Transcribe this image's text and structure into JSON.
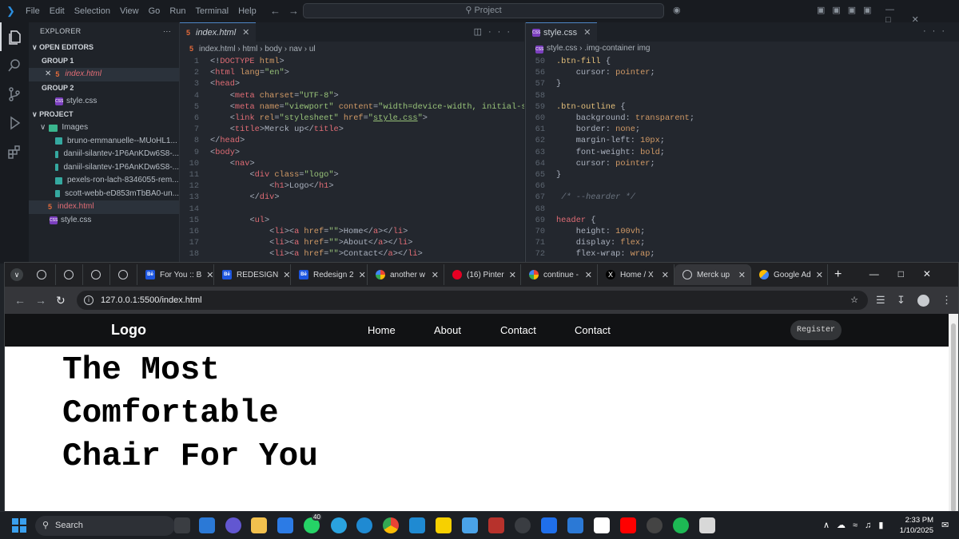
{
  "vscode": {
    "menu": [
      "File",
      "Edit",
      "Selection",
      "View",
      "Go",
      "Run",
      "Terminal",
      "Help"
    ],
    "command_center": "Project",
    "explorer": {
      "title": "EXPLORER",
      "open_editors": "OPEN EDITORS",
      "group1": "GROUP 1",
      "group1_file": "index.html",
      "group2": "GROUP 2",
      "group2_file": "style.css",
      "project": "PROJECT",
      "images_folder": "Images",
      "images": [
        "bruno-emmanuelle--MUoHL1...",
        "daniil-silantev-1P6AnKDw6S8-...",
        "daniil-silantev-1P6AnKDw6S8-...",
        "pexels-ron-lach-8346055-rem...",
        "scott-webb-eD853mTbBA0-un..."
      ],
      "files": [
        "index.html",
        "style.css"
      ]
    },
    "editor1": {
      "tab": "index.html",
      "crumbs": [
        "index.html",
        "html",
        "body",
        "nav",
        "ul"
      ]
    },
    "editor2": {
      "tab": "style.css",
      "crumbs": [
        "style.css",
        ".img-container img"
      ]
    }
  },
  "chrome": {
    "tabs": [
      {
        "title": "",
        "icon": "globe"
      },
      {
        "title": "",
        "icon": "globe"
      },
      {
        "title": "",
        "icon": "globe"
      },
      {
        "title": "",
        "icon": "globe"
      },
      {
        "title": "For You :: B",
        "icon": "behance"
      },
      {
        "title": "REDESIGN",
        "icon": "behance"
      },
      {
        "title": "Redesign 2",
        "icon": "behance"
      },
      {
        "title": "another w",
        "icon": "google"
      },
      {
        "title": "(16) Pinter",
        "icon": "pinterest"
      },
      {
        "title": "continue -",
        "icon": "google"
      },
      {
        "title": "Home / X",
        "icon": "x"
      },
      {
        "title": "Merck up",
        "icon": "globe"
      },
      {
        "title": "Google Ad",
        "icon": "ads"
      }
    ],
    "url": "127.0.0.1:5500/index.html"
  },
  "site": {
    "logo": "Logo",
    "nav": [
      "Home",
      "About",
      "Contact",
      "Contact"
    ],
    "register": "Register",
    "hero": [
      "The Most",
      "Comfortable",
      "Chair For You"
    ]
  },
  "taskbar": {
    "search": "Search",
    "badge": "40",
    "time": "2:33 PM",
    "date": "1/10/2025"
  }
}
